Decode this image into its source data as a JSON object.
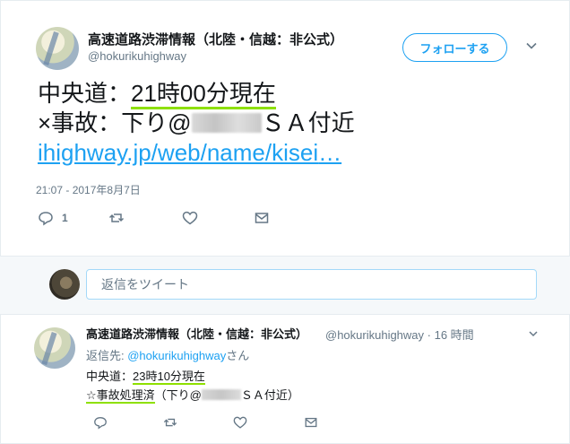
{
  "main_tweet": {
    "display_name": "高速道路渋滞情報（北陸・信越：非公式）",
    "handle": "@hokurikuhighway",
    "follow_label": "フォローする",
    "line1_prefix": "中央道：",
    "line1_underlined": "21時00分現在",
    "line2_prefix": "×事故：下り@",
    "line2_suffix": "ＳＡ付近",
    "link_text": "ihighway.jp/web/name/kisei",
    "link_ellipsis": "…",
    "timestamp": "21:07 - 2017年8月7日",
    "reply_count": "1"
  },
  "reply_box": {
    "placeholder": "返信をツイート"
  },
  "second_tweet": {
    "display_name": "高速道路渋滞情報（北陸・信越：非公式）",
    "meta": "@hokurikuhighway · 16 時間",
    "reply_prefix": "返信先: ",
    "reply_mention": "@hokurikuhighway",
    "reply_suffix": "さん",
    "line1_prefix": "中央道：",
    "line1_underlined": "23時10分現在",
    "line2_underlined": "☆事故処理済",
    "line2_middle": "（下り@",
    "line2_suffix": "ＳＡ付近）"
  },
  "colors": {
    "accent": "#1da1f2",
    "underline_highlight": "#8ee000",
    "muted": "#657786"
  },
  "icons": [
    "chevron-down-icon",
    "reply-icon",
    "retweet-icon",
    "like-icon",
    "message-icon"
  ]
}
